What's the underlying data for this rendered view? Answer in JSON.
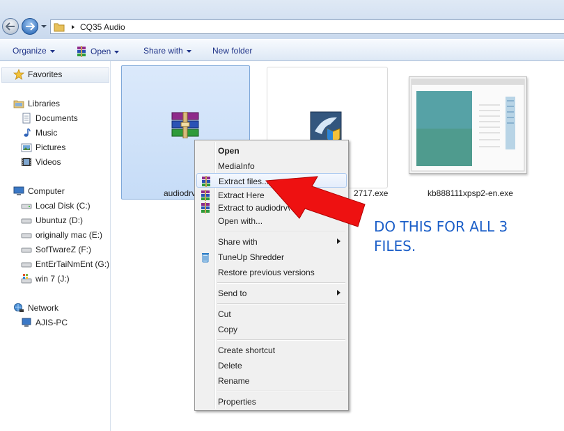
{
  "address": {
    "path": "CQ35 Audio",
    "icons": {
      "back": "back-arrow-icon",
      "forward": "forward-arrow-icon",
      "folder": "folder-icon"
    }
  },
  "toolbar": {
    "organize": "Organize",
    "open": "Open",
    "share_with": "Share with",
    "new_folder": "New folder"
  },
  "nav": {
    "favorites": "Favorites",
    "libraries": "Libraries",
    "library_items": [
      "Documents",
      "Music",
      "Pictures",
      "Videos"
    ],
    "computer": "Computer",
    "drives": [
      "Local Disk (C:)",
      "Ubuntuz (D:)",
      "originally mac (E:)",
      "SofTwareZ (F:)",
      "EntErTaiNmEnt (G:)",
      "win 7 (J:)"
    ],
    "network": "Network",
    "network_items": [
      "AJIS-PC"
    ]
  },
  "files": [
    {
      "label": "audiodrv",
      "icon": "winrar-archive-icon",
      "selected": true
    },
    {
      "label": "2717.exe",
      "icon": "installer-exe-icon",
      "selected": false
    },
    {
      "label": "kb888111xpsp2-en.exe",
      "icon": "document-thumbnail-icon",
      "selected": false
    }
  ],
  "context_menu": {
    "open": "Open",
    "mediainfo": "MediaInfo",
    "extract_files": "Extract files...",
    "extract_here": "Extract Here",
    "extract_to": "Extract to audiodrv\\",
    "open_with": "Open with...",
    "share_with": "Share with",
    "tuneup_shredder": "TuneUp Shredder",
    "restore_previous": "Restore previous versions",
    "send_to": "Send to",
    "cut": "Cut",
    "copy": "Copy",
    "create_shortcut": "Create shortcut",
    "delete": "Delete",
    "rename": "Rename",
    "properties": "Properties"
  },
  "annotation": {
    "line1": "DO THIS FOR ALL 3",
    "line2": "FILES.",
    "arrow_color": "#ee1111",
    "text_color": "#1c5fc8"
  }
}
